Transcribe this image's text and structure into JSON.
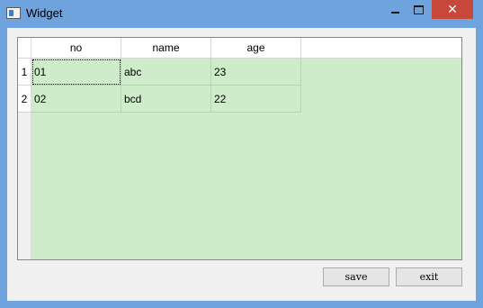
{
  "window": {
    "title": "Widget"
  },
  "table": {
    "columns": [
      "no",
      "name",
      "age"
    ],
    "row_headers": [
      "1",
      "2"
    ],
    "rows": [
      [
        "01",
        "abc",
        "23"
      ],
      [
        "02",
        "bcd",
        "22"
      ]
    ],
    "selected_cell": "01",
    "body_color": "#ceecca"
  },
  "buttons": {
    "save": "save",
    "exit": "exit"
  }
}
